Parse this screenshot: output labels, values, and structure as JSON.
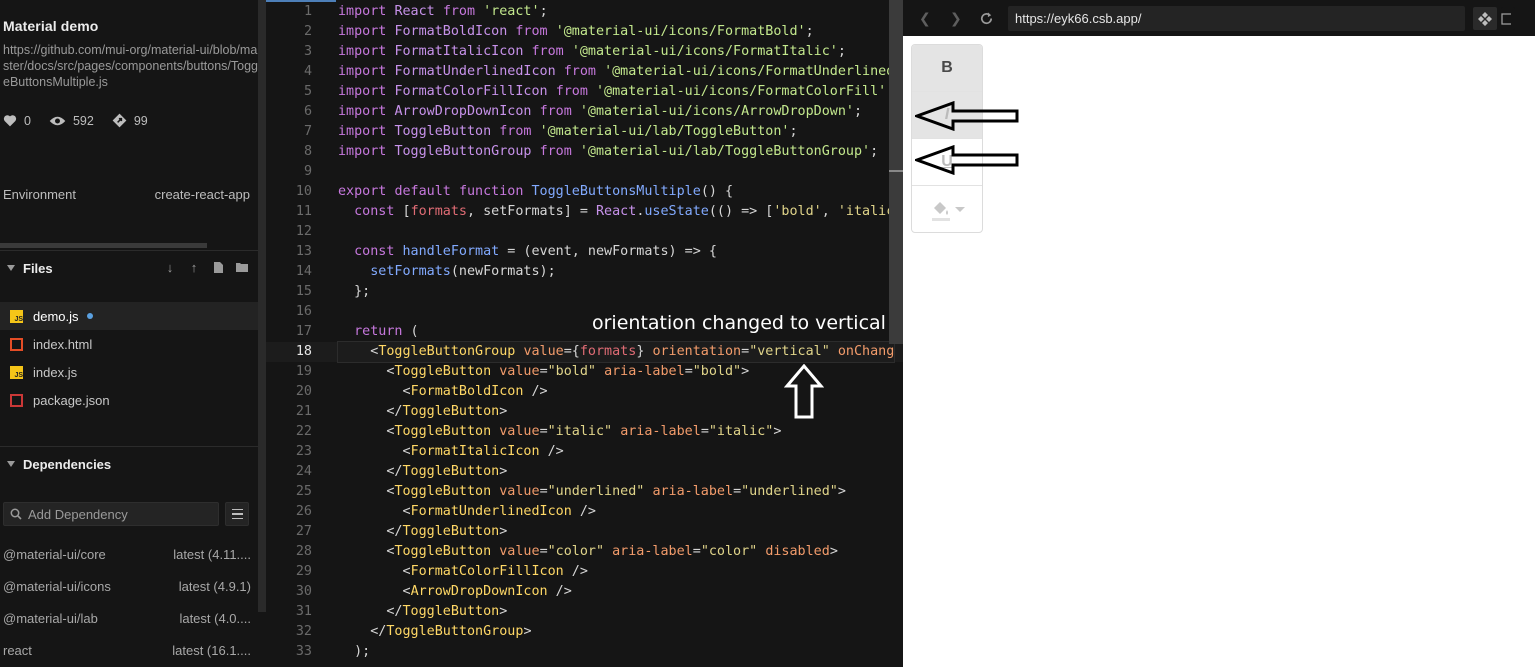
{
  "sidebar": {
    "title": "Material demo",
    "source_link": "https://github.com/mui-org/material-ui/blob/master/docs/src/pages/components/buttons/ToggleButtonsMultiple.js",
    "stats": {
      "likes": "0",
      "views": "592",
      "forks": "99"
    },
    "environment_label": "Environment",
    "environment_value": "create-react-app",
    "files_heading": "Files",
    "files": [
      {
        "name": "demo.js",
        "type": "js",
        "active": true,
        "unsaved": true
      },
      {
        "name": "index.html",
        "type": "html",
        "active": false
      },
      {
        "name": "index.js",
        "type": "js",
        "active": false
      },
      {
        "name": "package.json",
        "type": "json",
        "active": false
      }
    ],
    "dependencies_heading": "Dependencies",
    "add_dependency_placeholder": "Add Dependency",
    "dependencies": [
      {
        "name": "@material-ui/core",
        "version": "latest (4.11...."
      },
      {
        "name": "@material-ui/icons",
        "version": "latest (4.9.1)"
      },
      {
        "name": "@material-ui/lab",
        "version": "latest (4.0...."
      },
      {
        "name": "react",
        "version": "latest (16.1...."
      }
    ],
    "icons": {
      "like": "heart-icon",
      "views": "eye-icon",
      "forks": "fork-icon",
      "menu": "menu-icon",
      "search": "search-icon"
    }
  },
  "editor": {
    "current_line": 18,
    "lines": [
      [
        [
          "kw",
          "import"
        ],
        [
          "p",
          " "
        ],
        [
          "id",
          "React"
        ],
        [
          "p",
          " "
        ],
        [
          "kw",
          "from"
        ],
        [
          "p",
          " "
        ],
        [
          "str",
          "'react'"
        ],
        [
          "p",
          ";"
        ]
      ],
      [
        [
          "kw",
          "import"
        ],
        [
          "p",
          " "
        ],
        [
          "id",
          "FormatBoldIcon"
        ],
        [
          "p",
          " "
        ],
        [
          "kw",
          "from"
        ],
        [
          "p",
          " "
        ],
        [
          "str",
          "'@material-ui/icons/FormatBold'"
        ],
        [
          "p",
          ";"
        ]
      ],
      [
        [
          "kw",
          "import"
        ],
        [
          "p",
          " "
        ],
        [
          "id",
          "FormatItalicIcon"
        ],
        [
          "p",
          " "
        ],
        [
          "kw",
          "from"
        ],
        [
          "p",
          " "
        ],
        [
          "str",
          "'@material-ui/icons/FormatItalic'"
        ],
        [
          "p",
          ";"
        ]
      ],
      [
        [
          "kw",
          "import"
        ],
        [
          "p",
          " "
        ],
        [
          "id",
          "FormatUnderlinedIcon"
        ],
        [
          "p",
          " "
        ],
        [
          "kw",
          "from"
        ],
        [
          "p",
          " "
        ],
        [
          "str",
          "'@material-ui/icons/FormatUnderlined"
        ]
      ],
      [
        [
          "kw",
          "import"
        ],
        [
          "p",
          " "
        ],
        [
          "id",
          "FormatColorFillIcon"
        ],
        [
          "p",
          " "
        ],
        [
          "kw",
          "from"
        ],
        [
          "p",
          " "
        ],
        [
          "str",
          "'@material-ui/icons/FormatColorFill'"
        ]
      ],
      [
        [
          "kw",
          "import"
        ],
        [
          "p",
          " "
        ],
        [
          "id",
          "ArrowDropDownIcon"
        ],
        [
          "p",
          " "
        ],
        [
          "kw",
          "from"
        ],
        [
          "p",
          " "
        ],
        [
          "str",
          "'@material-ui/icons/ArrowDropDown'"
        ],
        [
          "p",
          ";"
        ]
      ],
      [
        [
          "kw",
          "import"
        ],
        [
          "p",
          " "
        ],
        [
          "id",
          "ToggleButton"
        ],
        [
          "p",
          " "
        ],
        [
          "kw",
          "from"
        ],
        [
          "p",
          " "
        ],
        [
          "str",
          "'@material-ui/lab/ToggleButton'"
        ],
        [
          "p",
          ";"
        ]
      ],
      [
        [
          "kw",
          "import"
        ],
        [
          "p",
          " "
        ],
        [
          "id",
          "ToggleButtonGroup"
        ],
        [
          "p",
          " "
        ],
        [
          "kw",
          "from"
        ],
        [
          "p",
          " "
        ],
        [
          "str",
          "'@material-ui/lab/ToggleButtonGroup'"
        ],
        [
          "p",
          ";"
        ]
      ],
      [],
      [
        [
          "kw",
          "export"
        ],
        [
          "p",
          " "
        ],
        [
          "kw",
          "default"
        ],
        [
          "p",
          " "
        ],
        [
          "kw",
          "function"
        ],
        [
          "p",
          " "
        ],
        [
          "fn",
          "ToggleButtonsMultiple"
        ],
        [
          "p",
          "() {"
        ]
      ],
      [
        [
          "p",
          "  "
        ],
        [
          "kw",
          "const"
        ],
        [
          "p",
          " ["
        ],
        [
          "var",
          "formats"
        ],
        [
          "p",
          ", setFormats] = "
        ],
        [
          "id",
          "React"
        ],
        [
          "p",
          "."
        ],
        [
          "fn",
          "useState"
        ],
        [
          "p",
          "(() => ["
        ],
        [
          "str2",
          "'bold'"
        ],
        [
          "p",
          ", "
        ],
        [
          "str2",
          "'italic"
        ]
      ],
      [],
      [
        [
          "p",
          "  "
        ],
        [
          "kw",
          "const"
        ],
        [
          "p",
          " "
        ],
        [
          "fn",
          "handleFormat"
        ],
        [
          "p",
          " = (event, newFormats) => {"
        ]
      ],
      [
        [
          "p",
          "    "
        ],
        [
          "fn",
          "setFormats"
        ],
        [
          "p",
          "(newFormats);"
        ]
      ],
      [
        [
          "p",
          "  };"
        ]
      ],
      [],
      [
        [
          "p",
          "  "
        ],
        [
          "kw",
          "return"
        ],
        [
          "p",
          " ("
        ]
      ],
      [
        [
          "p",
          "    <"
        ],
        [
          "tag",
          "ToggleButtonGroup"
        ],
        [
          "p",
          " "
        ],
        [
          "attr",
          "value"
        ],
        [
          "p",
          "={"
        ],
        [
          "var",
          "formats"
        ],
        [
          "p",
          "} "
        ],
        [
          "attr",
          "orientation"
        ],
        [
          "p",
          "="
        ],
        [
          "str2",
          "\"vertical\""
        ],
        [
          "p",
          " "
        ],
        [
          "attr",
          "onChang"
        ]
      ],
      [
        [
          "p",
          "      <"
        ],
        [
          "tag",
          "ToggleButton"
        ],
        [
          "p",
          " "
        ],
        [
          "attr",
          "value"
        ],
        [
          "p",
          "="
        ],
        [
          "str2",
          "\"bold\""
        ],
        [
          "p",
          " "
        ],
        [
          "attr",
          "aria-label"
        ],
        [
          "p",
          "="
        ],
        [
          "str2",
          "\"bold\""
        ],
        [
          "p",
          ">"
        ]
      ],
      [
        [
          "p",
          "        <"
        ],
        [
          "tag",
          "FormatBoldIcon"
        ],
        [
          "p",
          " />"
        ]
      ],
      [
        [
          "p",
          "      </"
        ],
        [
          "tag",
          "ToggleButton"
        ],
        [
          "p",
          ">"
        ]
      ],
      [
        [
          "p",
          "      <"
        ],
        [
          "tag",
          "ToggleButton"
        ],
        [
          "p",
          " "
        ],
        [
          "attr",
          "value"
        ],
        [
          "p",
          "="
        ],
        [
          "str2",
          "\"italic\""
        ],
        [
          "p",
          " "
        ],
        [
          "attr",
          "aria-label"
        ],
        [
          "p",
          "="
        ],
        [
          "str2",
          "\"italic\""
        ],
        [
          "p",
          ">"
        ]
      ],
      [
        [
          "p",
          "        <"
        ],
        [
          "tag",
          "FormatItalicIcon"
        ],
        [
          "p",
          " />"
        ]
      ],
      [
        [
          "p",
          "      </"
        ],
        [
          "tag",
          "ToggleButton"
        ],
        [
          "p",
          ">"
        ]
      ],
      [
        [
          "p",
          "      <"
        ],
        [
          "tag",
          "ToggleButton"
        ],
        [
          "p",
          " "
        ],
        [
          "attr",
          "value"
        ],
        [
          "p",
          "="
        ],
        [
          "str2",
          "\"underlined\""
        ],
        [
          "p",
          " "
        ],
        [
          "attr",
          "aria-label"
        ],
        [
          "p",
          "="
        ],
        [
          "str2",
          "\"underlined\""
        ],
        [
          "p",
          ">"
        ]
      ],
      [
        [
          "p",
          "        <"
        ],
        [
          "tag",
          "FormatUnderlinedIcon"
        ],
        [
          "p",
          " />"
        ]
      ],
      [
        [
          "p",
          "      </"
        ],
        [
          "tag",
          "ToggleButton"
        ],
        [
          "p",
          ">"
        ]
      ],
      [
        [
          "p",
          "      <"
        ],
        [
          "tag",
          "ToggleButton"
        ],
        [
          "p",
          " "
        ],
        [
          "attr",
          "value"
        ],
        [
          "p",
          "="
        ],
        [
          "str2",
          "\"color\""
        ],
        [
          "p",
          " "
        ],
        [
          "attr",
          "aria-label"
        ],
        [
          "p",
          "="
        ],
        [
          "str2",
          "\"color\""
        ],
        [
          "p",
          " "
        ],
        [
          "attr",
          "disabled"
        ],
        [
          "p",
          ">"
        ]
      ],
      [
        [
          "p",
          "        <"
        ],
        [
          "tag",
          "FormatColorFillIcon"
        ],
        [
          "p",
          " />"
        ]
      ],
      [
        [
          "p",
          "        <"
        ],
        [
          "tag",
          "ArrowDropDownIcon"
        ],
        [
          "p",
          " />"
        ]
      ],
      [
        [
          "p",
          "      </"
        ],
        [
          "tag",
          "ToggleButton"
        ],
        [
          "p",
          ">"
        ]
      ],
      [
        [
          "p",
          "    </"
        ],
        [
          "tag",
          "ToggleButtonGroup"
        ],
        [
          "p",
          ">"
        ]
      ],
      [
        [
          "p",
          "  );"
        ]
      ]
    ]
  },
  "annotation": {
    "text": "orientation changed to vertical",
    "arrow_icon": "arrow-up-icon"
  },
  "preview": {
    "url": "https://eyk66.csb.app/",
    "toggle_buttons": [
      {
        "label": "B",
        "selected": true,
        "disabled": false,
        "icon": "format-bold-icon"
      },
      {
        "label": "I",
        "selected": true,
        "disabled": false,
        "icon": "format-italic-icon"
      },
      {
        "label": "U",
        "selected": false,
        "disabled": false,
        "icon": "format-underlined-icon"
      },
      {
        "label": "",
        "selected": false,
        "disabled": true,
        "icon": "format-color-fill-icon"
      }
    ],
    "annotation_arrows": [
      "arrow-left-icon",
      "arrow-left-icon"
    ]
  },
  "colors": {
    "background": "#151515",
    "keyword": "#c678dd",
    "string": "#c3e88d",
    "tag": "#ffd866",
    "attribute": "#f39c6b",
    "active_file_dot": "#5aa0e0"
  }
}
